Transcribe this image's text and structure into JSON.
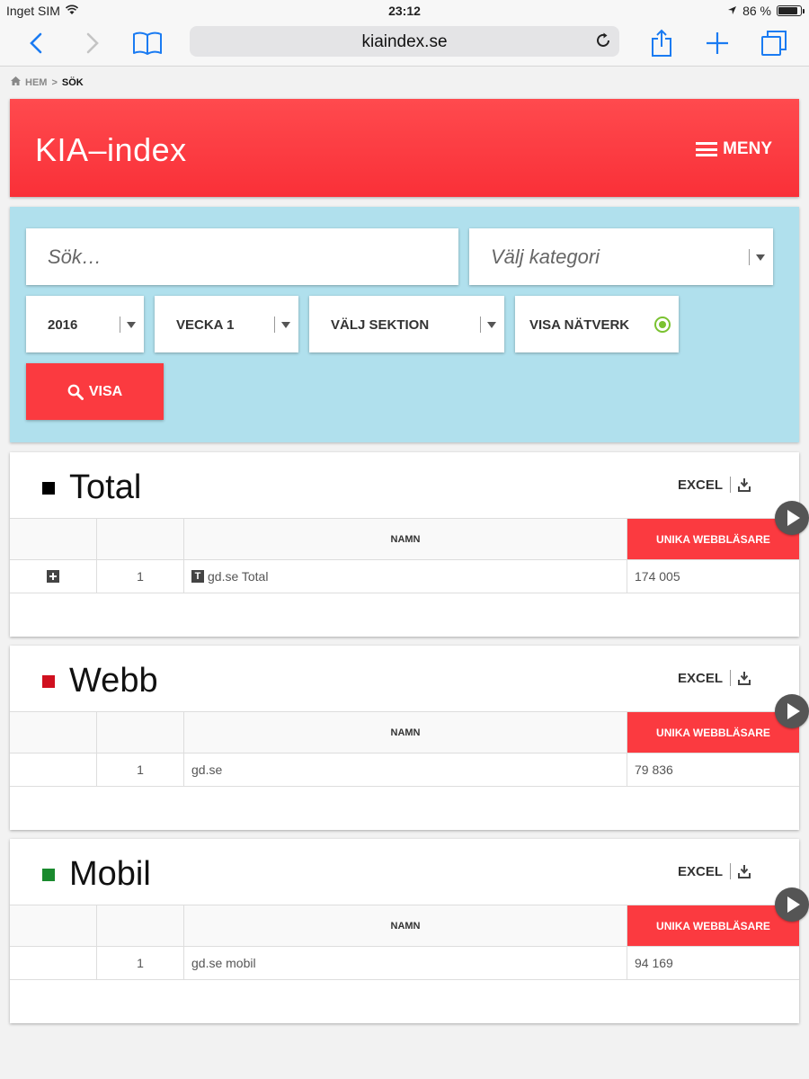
{
  "status": {
    "carrier": "Inget SIM",
    "time": "23:12",
    "battery_text": "86 %",
    "battery_level": 0.86
  },
  "browser": {
    "url": "kiaindex.se"
  },
  "breadcrumb": {
    "home": "HEM",
    "separator": ">",
    "current": "SÖK"
  },
  "header": {
    "logo": "KIA–index",
    "menu_label": "MENY"
  },
  "search": {
    "query_placeholder": "Sök…",
    "category_placeholder": "Välj kategori",
    "year": "2016",
    "week": "VECKA 1",
    "section": "VÄLJ SEKTION",
    "network_toggle": "VISA NÄTVERK",
    "submit_label": "VISA"
  },
  "colors": {
    "brand_red": "#fb3a40",
    "panel_blue": "#b0e0ed",
    "total_square": "#000000",
    "webb_square": "#d0101f",
    "mobil_square": "#1a8a2e",
    "toggle_green": "#7ac230"
  },
  "sections": [
    {
      "title": "Total",
      "excel_label": "EXCEL",
      "columns": [
        "",
        "",
        "NAMN",
        "UNIKA WEBBLÄSARE"
      ],
      "rows": [
        {
          "rank": "1",
          "name": "gd.se Total",
          "value": "174 005"
        }
      ]
    },
    {
      "title": "Webb",
      "excel_label": "EXCEL",
      "columns": [
        "",
        "",
        "NAMN",
        "UNIKA WEBBLÄSARE"
      ],
      "rows": [
        {
          "rank": "1",
          "name": "gd.se",
          "value": "79 836"
        }
      ]
    },
    {
      "title": "Mobil",
      "excel_label": "EXCEL",
      "columns": [
        "",
        "",
        "NAMN",
        "UNIKA WEBBLÄSARE"
      ],
      "rows": [
        {
          "rank": "1",
          "name": "gd.se mobil",
          "value": "94 169"
        }
      ]
    }
  ]
}
